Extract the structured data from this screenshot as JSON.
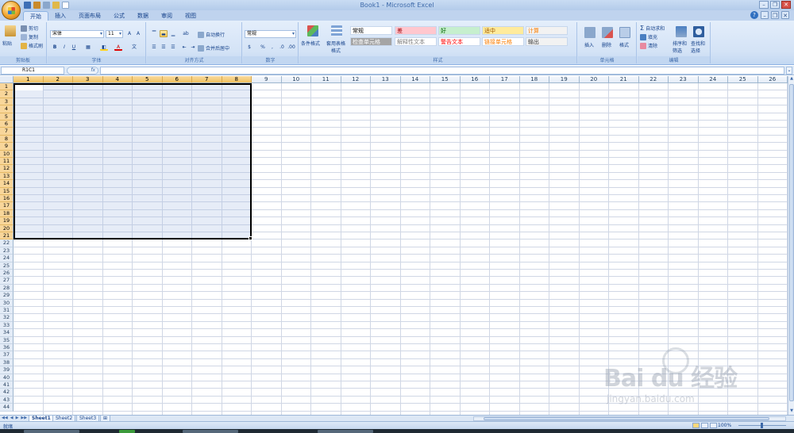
{
  "window": {
    "title": "Book1 - Microsoft Excel"
  },
  "ribbon_tabs": [
    "开始",
    "插入",
    "页面布局",
    "公式",
    "数据",
    "审阅",
    "视图"
  ],
  "clipboard": {
    "paste": "粘贴",
    "cut": "剪切",
    "copy": "复制",
    "format_painter": "格式刷",
    "group_label": "剪贴板"
  },
  "font": {
    "name": "宋体",
    "size": "11",
    "group_label": "字体",
    "bold": "B",
    "italic": "I",
    "underline": "U"
  },
  "alignment": {
    "wrap_text": "自动换行",
    "merge_center": "合并后居中",
    "group_label": "对齐方式"
  },
  "number": {
    "format": "常规",
    "group_label": "数字"
  },
  "styles": {
    "conditional_format": "条件格式",
    "format_as_table": "套用表格格式",
    "group_label": "样式",
    "cells": [
      {
        "label": "常规",
        "bg": "#ffffff",
        "fg": "#000000"
      },
      {
        "label": "差",
        "bg": "#ffc7ce",
        "fg": "#9c0006"
      },
      {
        "label": "好",
        "bg": "#c6efce",
        "fg": "#006100"
      },
      {
        "label": "适中",
        "bg": "#ffeb9c",
        "fg": "#9c5700"
      },
      {
        "label": "计算",
        "bg": "#f2f2f2",
        "fg": "#fa7d00"
      },
      {
        "label": "检查单元格",
        "bg": "#a5a5a5",
        "fg": "#ffffff"
      },
      {
        "label": "解释性文本",
        "bg": "#ffffff",
        "fg": "#7f7f7f"
      },
      {
        "label": "警告文本",
        "bg": "#ffffff",
        "fg": "#ff0000"
      },
      {
        "label": "链接单元格",
        "bg": "#ffffff",
        "fg": "#fa7d00"
      },
      {
        "label": "输出",
        "bg": "#f2f2f2",
        "fg": "#3f3f3f"
      }
    ]
  },
  "cells_group": {
    "insert": "插入",
    "delete": "删除",
    "format": "格式",
    "group_label": "单元格"
  },
  "editing": {
    "autosum": "自动求和",
    "fill": "填充",
    "clear": "清除",
    "sort_filter": "排序和筛选",
    "find_select": "查找和选择",
    "group_label": "编辑"
  },
  "formula_bar": {
    "name_box": "R1C1",
    "fx": "fx",
    "content": ""
  },
  "grid": {
    "columns": [
      "1",
      "2",
      "3",
      "4",
      "5",
      "6",
      "7",
      "8",
      "9",
      "10",
      "11",
      "12",
      "13",
      "14",
      "15",
      "16",
      "17",
      "18",
      "19",
      "20",
      "21",
      "22",
      "23",
      "24",
      "25",
      "26"
    ],
    "rows": [
      "1",
      "2",
      "3",
      "4",
      "5",
      "6",
      "7",
      "8",
      "9",
      "10",
      "11",
      "12",
      "13",
      "14",
      "15",
      "16",
      "17",
      "18",
      "19",
      "20",
      "21",
      "22",
      "23",
      "24",
      "25",
      "26",
      "27",
      "28",
      "29",
      "30",
      "31",
      "32",
      "33",
      "34",
      "35",
      "36",
      "37",
      "38",
      "39",
      "40",
      "41",
      "42",
      "43",
      "44"
    ],
    "selected_cols": 8,
    "selected_rows": 21
  },
  "sheets": [
    "Sheet1",
    "Sheet2",
    "Sheet3"
  ],
  "active_sheet": "Sheet1",
  "status": {
    "text": "就绪",
    "zoom": "100%"
  },
  "watermark": {
    "main": "Bai du 经验",
    "sub": "jingyan.baidu.com"
  },
  "colors": {
    "accent": "#15428b",
    "selection_header": "#f1c15f",
    "ribbon": "#d4e3f6"
  }
}
